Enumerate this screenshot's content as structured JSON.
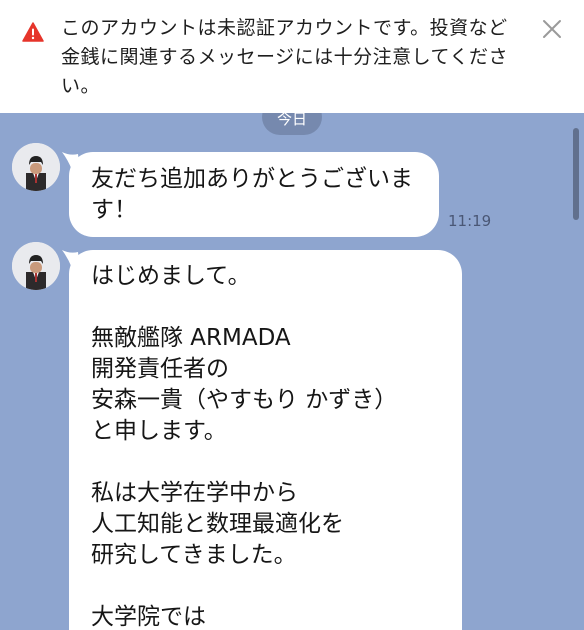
{
  "banner": {
    "message": "このアカウントは未認証アカウントです。投資など金銭に関連するメッセージには十分注意してください。",
    "warning_icon": "warning-triangle-icon",
    "close_icon": "close-icon",
    "accent_color": "#e6352b"
  },
  "chat": {
    "date_label": "今日",
    "background_color": "#8ea5cf",
    "messages": [
      {
        "avatar": "sender-avatar",
        "text": "友だち追加ありがとうございます！",
        "time": "11:19"
      },
      {
        "avatar": "sender-avatar",
        "text": "はじめまして。\n\n無敵艦隊 ARMADA\n開発責任者の\n安森一貴（やすもり かずき）\nと申します。\n\n私は大学在学中から\n人工知能と数理最適化を\n研究してきました。\n\n大学院では"
      }
    ]
  }
}
